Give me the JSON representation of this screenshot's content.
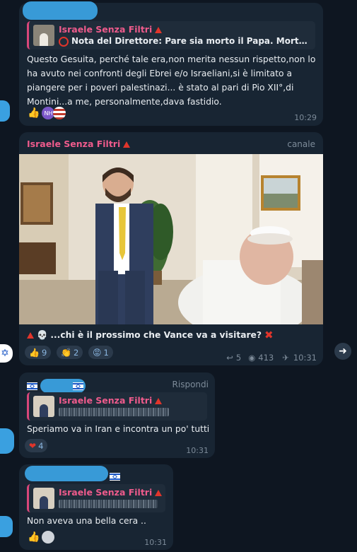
{
  "colors": {
    "bg": "#0e1621",
    "bubble": "#182533",
    "accent": "#ef5b8c",
    "redacted": "#3aa0e0"
  },
  "msg1": {
    "reply_name": "Israele Senza Filtri",
    "reply_text": "Nota del Direttore: Pare sia morto il Papa. Morto u...",
    "text": "Questo Gesuita, perché tale era,non merita nessun rispetto,non lo ha avuto nei confronti degli Ebrei e/o Israeliani,si è limitato a piangere per i poveri palestinazi... è stato al pari di Pio XII°,di Montini...a me, personalmente,dava fastidio.",
    "avatar_initials": "NH",
    "time": "10:29"
  },
  "post": {
    "channel": "Israele Senza Filtri",
    "tag": "canale",
    "caption": "...chi è il prossimo che Vance va a visitare?",
    "reactions": [
      {
        "icon": "thumbs-up",
        "count": "9"
      },
      {
        "icon": "clapping-hands",
        "count": "2"
      },
      {
        "icon": "angry-face",
        "count": "1"
      }
    ],
    "replies": "5",
    "views": "413",
    "time": "10:31"
  },
  "msg2": {
    "action": "Rispondi",
    "reply_name": "Israele Senza Filtri",
    "text": "Speriamo va in Iran e incontra un po' tutti :)",
    "reaction_count": "4",
    "time": "10:31"
  },
  "msg3": {
    "reply_name": "Israele Senza Filtri",
    "text": "Non aveva una bella cera ..",
    "time": "10:31"
  }
}
